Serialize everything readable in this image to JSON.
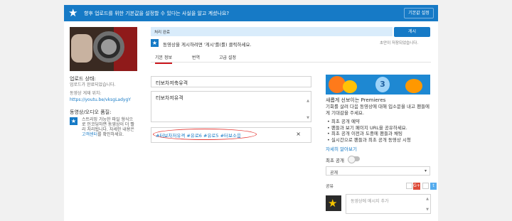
{
  "banner": {
    "text": "향후 업로드를 위한 기본값을 설정할 수 있다는 사실을 알고 계셨나요?",
    "button": "기본값 설정",
    "icon": "star-icon"
  },
  "left": {
    "upload_status_label": "업로드 상태:",
    "upload_status_value": "업로드가 완료되었습니다.",
    "video_link_label": "동영상 게재 위치:",
    "video_link": "https://youtu.be/vksgLadygY",
    "quality_label": "동영상/오디오 품질:",
    "quality_text_1": "스트리밍 가능한 파일 형식으",
    "quality_text_2": "로 인코딩하면 동영상이 더 빨",
    "quality_text_3": "리 처리됩니다. 자세한 내용은",
    "quality_link": "고객센터",
    "quality_text_4": "를 확인하세요."
  },
  "status": {
    "progress_text": "처리 완료",
    "progress": 1.0,
    "publish_button": "게시",
    "notice": "동영상을 게시하려면 '게시'를(를) 클릭하세요.",
    "draft_saved": "초안이 저장되었습니다."
  },
  "tabs": [
    {
      "label": "기본 정보",
      "active": true
    },
    {
      "label": "번역",
      "active": false
    },
    {
      "label": "고급 설정",
      "active": false
    }
  ],
  "form": {
    "title": "터보차저축유격",
    "description": "터보차저유격",
    "tags": "#터보차저유격 #유로6 #유로5 #터보소음"
  },
  "premiere": {
    "badge_number": "3",
    "title": "새롭게 선보이는 Premieres",
    "body": "기회를 살려 다음 동영상에 대해 입소문을 내고 팬들에게 기대감을 주세요.",
    "bullets": [
      "• 최초 공개 예약",
      "• 팬들과 보기 페이지 URL을 공유하세요.",
      "• 최초 공개 이전과 도중에 팬들과 채팅",
      "• 실시간으로 팬들과 최초 공개 동영상 시청"
    ],
    "learn_more": "자세히 알아보기",
    "toggle_label": "최초 공개",
    "toggle_on": false
  },
  "visibility": {
    "value": "공개"
  },
  "share": {
    "label": "공유",
    "comment_placeholder": "동영상에 메시지 추가"
  },
  "colors": {
    "accent": "#167ac6",
    "tab_active": "#cc181e",
    "tag_highlight": "#e53935"
  }
}
